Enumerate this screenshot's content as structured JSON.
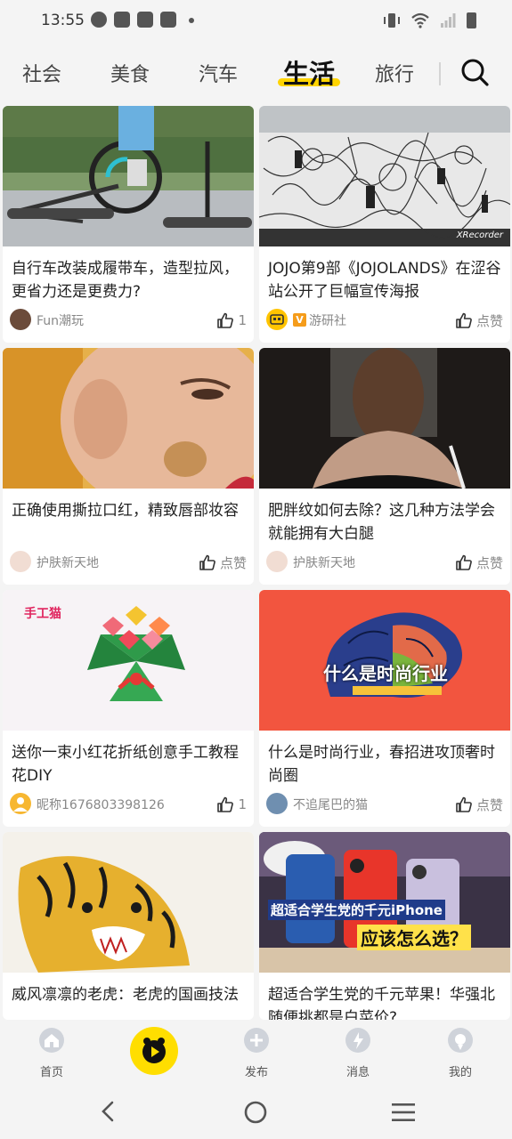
{
  "status_bar": {
    "time": "13:55"
  },
  "tabs": [
    {
      "label": "社会",
      "active": false
    },
    {
      "label": "美食",
      "active": false
    },
    {
      "label": "汽车",
      "active": false
    },
    {
      "label": "生活",
      "active": true
    },
    {
      "label": "旅行",
      "active": false
    }
  ],
  "accent_color": "#ffd400",
  "feed": [
    {
      "title": "自行车改装成履带车，造型拉风，更省力还是更费力?",
      "author": "Fun潮玩",
      "likes": "1",
      "thumb_caption": ""
    },
    {
      "title": "JOJO第9部《JOJOLANDS》在涩谷站公开了巨幅宣传海报",
      "author": "游研社",
      "likes": "点赞",
      "thumb_caption": "XRecorder"
    },
    {
      "title": "正确使用撕拉口红，精致唇部妆容",
      "author": "护肤新天地",
      "likes": "点赞",
      "thumb_caption": ""
    },
    {
      "title": "肥胖纹如何去除？这几种方法学会就能拥有大白腿",
      "author": "护肤新天地",
      "likes": "点赞",
      "thumb_caption": ""
    },
    {
      "title": "送你一束小红花折纸创意手工教程花DIY",
      "author": "昵称1676803398126",
      "likes": "1",
      "thumb_caption": "手工猫"
    },
    {
      "title": "什么是时尚行业，春招进攻顶奢时尚圈",
      "author": "不追尾巴的猫",
      "likes": "点赞",
      "thumb_caption": "什么是时尚行业"
    },
    {
      "title": "威风凛凛的老虎：老虎的国画技法",
      "author": "",
      "likes": "",
      "thumb_caption": ""
    },
    {
      "title": "超适合学生党的千元苹果！华强北随便挑都是白菜价?",
      "author": "",
      "likes": "",
      "thumb_caption": "超适合学生党的千元iPhone",
      "thumb_caption2": "应该怎么选？"
    }
  ],
  "bottom_nav": [
    {
      "label": "首页",
      "icon": "home-icon"
    },
    {
      "label": "",
      "icon": "play-icon"
    },
    {
      "label": "发布",
      "icon": "plus-icon"
    },
    {
      "label": "消息",
      "icon": "bell-icon"
    },
    {
      "label": "我的",
      "icon": "profile-icon"
    }
  ]
}
